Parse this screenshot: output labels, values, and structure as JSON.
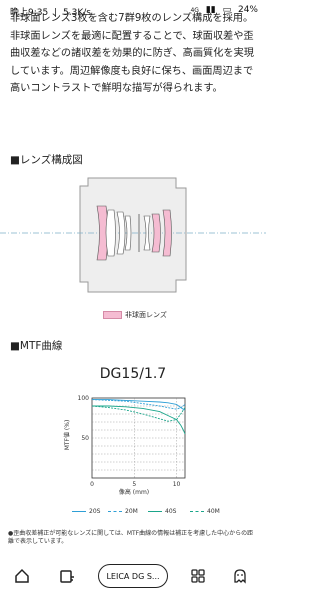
{
  "status_bar": {
    "time": "晩上9:35",
    "speed": "5.3K/s",
    "network": "4G",
    "battery": "24%"
  },
  "article": {
    "paragraph": "非球面レンズ3枚を含む7群9枚のレンズ構成を採用。非球面レンズを最適に配置することで、球面収差や歪曲収差などの諸収差を効果的に防ぎ、高画質化を実現しています。周辺解像度も良好に保ち、画面周辺まで高いコントラストで鮮明な描写が得られます。",
    "lens_section_title": "■レンズ構成図",
    "legend_label": "非球面レンズ",
    "mtf_section_title": "■MTF曲線",
    "mtf_chart_title": "DG15/1.7",
    "note": "●歪曲収差補正が可能なレンズに関しては、MTF曲線の情報は補正を考慮した中心からの距離で表示しています。"
  },
  "colors": {
    "aspherical": "#f5bcd2",
    "lens_body": "#d9d9d9",
    "series_blue": "#2e9fd6",
    "series_green": "#1aa58a"
  },
  "chart_data": {
    "type": "line",
    "title": "DG15/1.7",
    "xlabel": "像高 (mm)",
    "ylabel": "MTF値 (%)",
    "xlim": [
      0,
      11
    ],
    "ylim": [
      0,
      100
    ],
    "xticks": [
      0,
      5,
      10
    ],
    "yticks": [
      50,
      100
    ],
    "grid": true,
    "legend": "bottom",
    "series": [
      {
        "name": "20S",
        "color": "#2e9fd6",
        "dash": "solid",
        "x": [
          0,
          2,
          4,
          6,
          8,
          9,
          10,
          10.5,
          10.8,
          11
        ],
        "y": [
          98,
          98,
          97,
          96,
          95,
          94,
          92,
          88,
          86,
          85
        ]
      },
      {
        "name": "20M",
        "color": "#2e9fd6",
        "dash": "dashed",
        "x": [
          0,
          2,
          4,
          6,
          8,
          9,
          10,
          10.5,
          10.8,
          11
        ],
        "y": [
          98,
          97,
          96,
          93,
          90,
          88,
          86,
          88,
          90,
          92
        ]
      },
      {
        "name": "40S",
        "color": "#1aa58a",
        "dash": "solid",
        "x": [
          0,
          2,
          4,
          6,
          8,
          9,
          10,
          10.5,
          10.8,
          11
        ],
        "y": [
          90,
          90,
          89,
          87,
          83,
          78,
          73,
          66,
          60,
          55
        ]
      },
      {
        "name": "40M",
        "color": "#1aa58a",
        "dash": "dashed",
        "x": [
          0,
          2,
          4,
          6,
          8,
          9,
          10,
          10.5,
          10.8,
          11
        ],
        "y": [
          90,
          88,
          85,
          80,
          74,
          71,
          73,
          80,
          85,
          88
        ]
      }
    ]
  },
  "bottom_nav": {
    "url_label": "LEICA DG S..."
  }
}
